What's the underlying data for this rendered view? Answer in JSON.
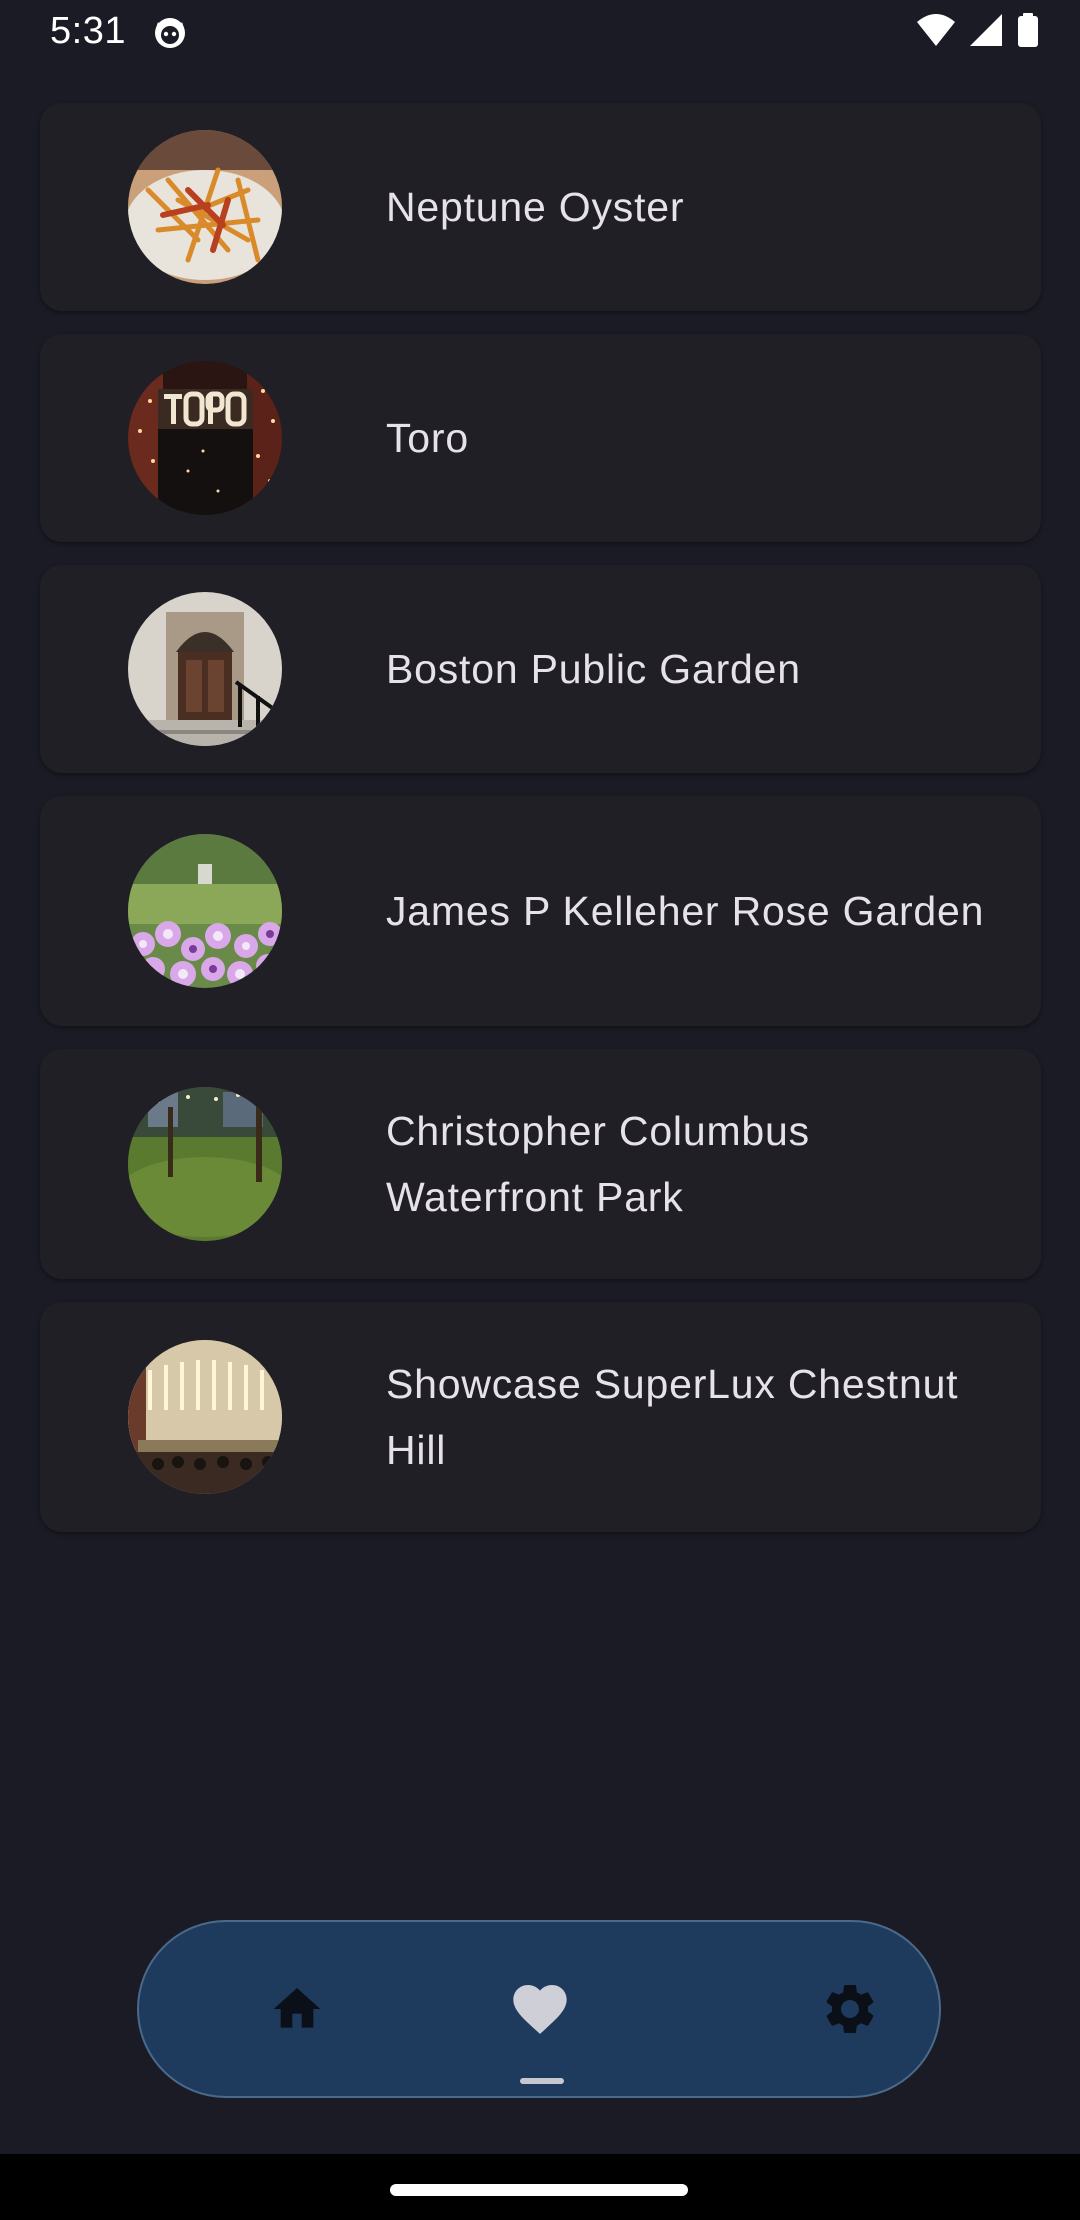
{
  "status_bar": {
    "time": "5:31"
  },
  "places": [
    {
      "name": "Neptune Oyster",
      "image": "fries-dish"
    },
    {
      "name": "Toro",
      "image": "toro-sign"
    },
    {
      "name": "Boston Public Garden",
      "image": "doorway"
    },
    {
      "name": "James P Kelleher Rose Garden",
      "image": "flowers"
    },
    {
      "name": "Christopher Columbus Waterfront Park",
      "image": "park-lawn"
    },
    {
      "name": "Showcase SuperLux Chestnut Hill",
      "image": "theater-hall"
    }
  ],
  "bottom_nav": {
    "items": [
      {
        "icon": "home-icon"
      },
      {
        "icon": "heart-icon",
        "selected": true
      },
      {
        "icon": "gear-icon"
      }
    ]
  },
  "colors": {
    "background": "#1a1b24",
    "card": "#211f26",
    "nav_bar": "#1e3a5c",
    "nav_icon": "#0b0f18",
    "nav_icon_selected": "#cfcfd8"
  }
}
